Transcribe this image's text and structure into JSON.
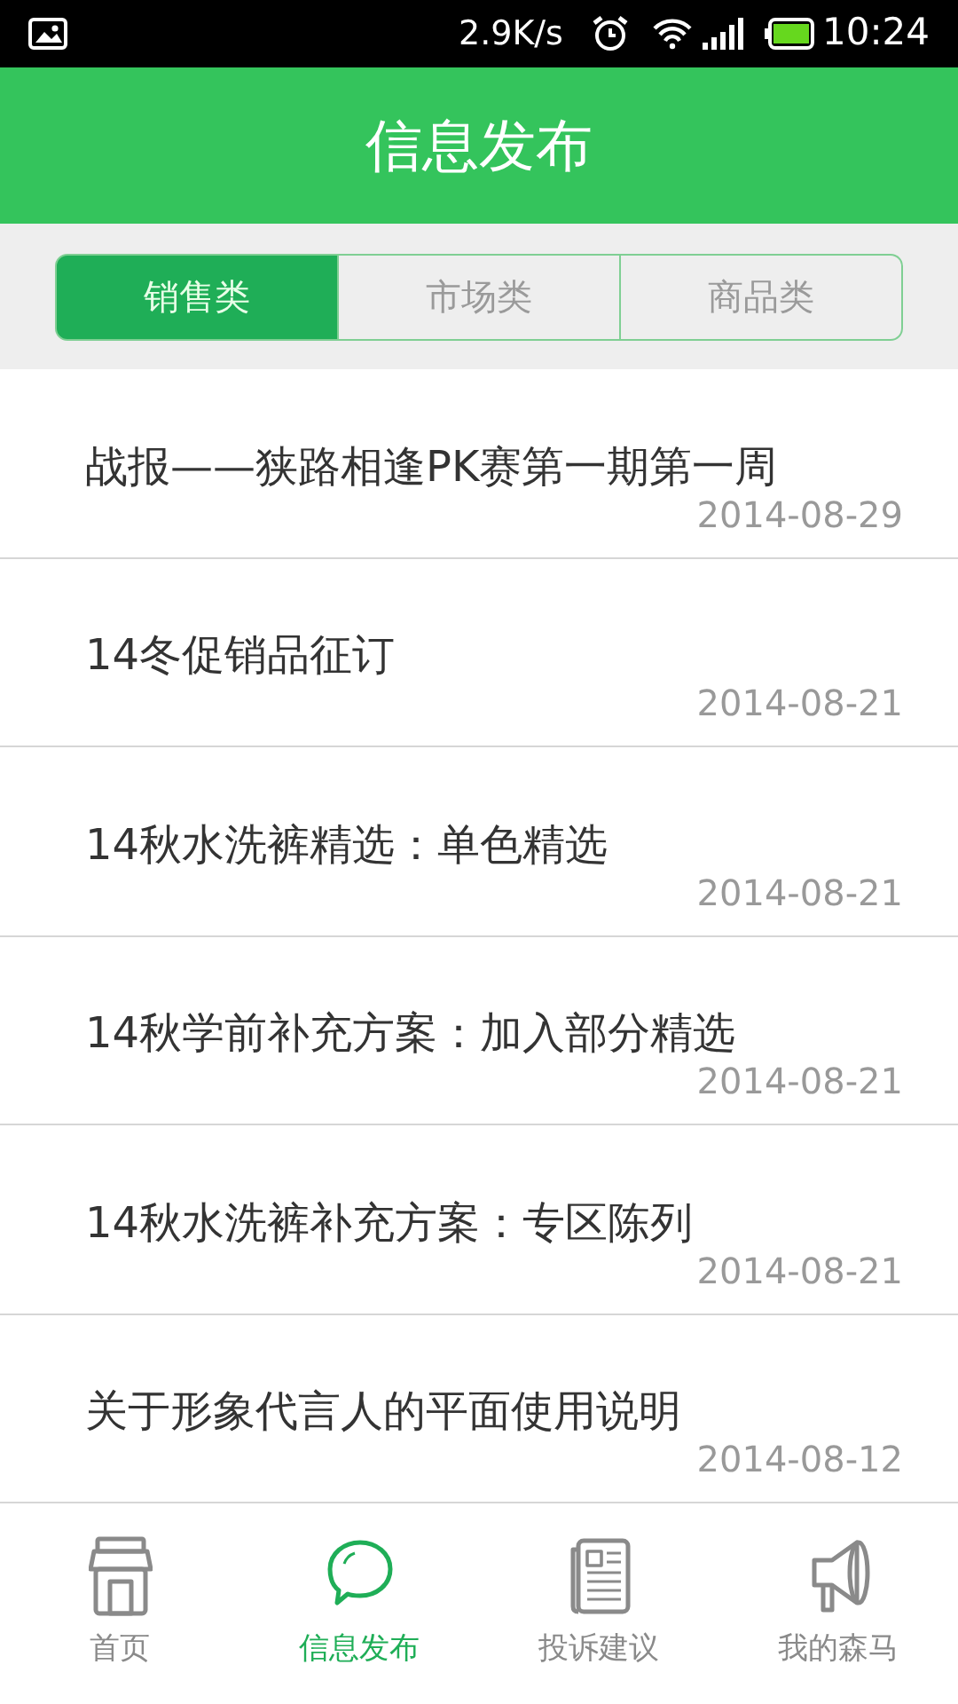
{
  "status_bar": {
    "speed": "2.9K/s",
    "time": "10:24"
  },
  "header": {
    "title": "信息发布"
  },
  "tabs": [
    {
      "label": "销售类",
      "selected": true
    },
    {
      "label": "市场类",
      "selected": false
    },
    {
      "label": "商品类",
      "selected": false
    }
  ],
  "posts": [
    {
      "title": "战报——狭路相逢PK赛第一期第一周",
      "date": "2014-08-29"
    },
    {
      "title": "14冬促销品征订",
      "date": "2014-08-21"
    },
    {
      "title": "14秋水洗裤精选：单色精选",
      "date": "2014-08-21"
    },
    {
      "title": "14秋学前补充方案：加入部分精选",
      "date": "2014-08-21"
    },
    {
      "title": "14秋水洗裤补充方案：专区陈列",
      "date": "2014-08-21"
    },
    {
      "title": "关于形象代言人的平面使用说明",
      "date": "2014-08-12"
    }
  ],
  "bottom_nav": [
    {
      "kind": "store",
      "label": "首页",
      "selected": false
    },
    {
      "kind": "chat",
      "label": "信息发布",
      "selected": true
    },
    {
      "kind": "news",
      "label": "投诉建议",
      "selected": false
    },
    {
      "kind": "megaphone",
      "label": "我的森马",
      "selected": false
    }
  ]
}
